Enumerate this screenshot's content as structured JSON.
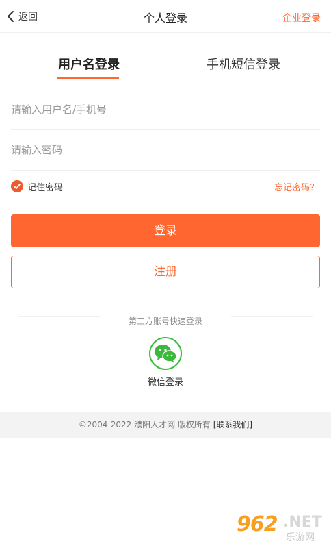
{
  "nav": {
    "back_label": "返回",
    "title": "个人登录",
    "enterprise_login": "企业登录"
  },
  "tabs": [
    {
      "label": "用户名登录",
      "active": true
    },
    {
      "label": "手机短信登录",
      "active": false
    }
  ],
  "form": {
    "username_placeholder": "请输入用户名/手机号",
    "username_value": "",
    "password_placeholder": "请输入密码",
    "password_value": "",
    "remember_label": "记住密码",
    "remember_checked": true,
    "forgot_label": "忘记密码？"
  },
  "buttons": {
    "login": "登录",
    "register": "注册"
  },
  "third_party": {
    "label": "第三方账号快速登录",
    "wechat_label": "微信登录"
  },
  "footer": {
    "copyright": "©2004-2022 濮阳人才网 版权所有 ",
    "contact": "[联系我们]"
  },
  "watermark": {
    "number": "962",
    "suffix": ".NET",
    "cn": "乐游网"
  },
  "colors": {
    "accent": "#ff6630",
    "wechat": "#3bb93b"
  },
  "icons": {
    "back": "chevron-left-icon",
    "remember": "check-circle-icon",
    "wechat": "wechat-icon"
  }
}
